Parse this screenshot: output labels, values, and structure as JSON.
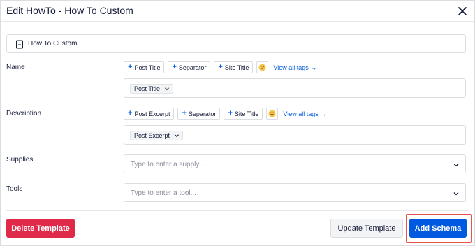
{
  "header": {
    "title": "Edit HowTo - How To Custom"
  },
  "title_field": {
    "value": "How To Custom"
  },
  "name": {
    "label": "Name",
    "tags": [
      "Post Title",
      "Separator",
      "Site Title"
    ],
    "emoji": "😀",
    "view_all": "View all tags →",
    "chip": "Post Title"
  },
  "description": {
    "label": "Description",
    "tags": [
      "Post Excerpt",
      "Separator",
      "Site Title"
    ],
    "emoji": "😀",
    "view_all": "View all tags →",
    "chip": "Post Excerpt"
  },
  "supplies": {
    "label": "Supplies",
    "placeholder": "Type to enter a supply..."
  },
  "tools": {
    "label": "Tools",
    "placeholder": "Type to enter a tool..."
  },
  "footer": {
    "delete_label": "Delete Template",
    "update_label": "Update Template",
    "add_label": "Add Schema"
  },
  "colors": {
    "accent": "#005ae0",
    "danger": "#df2a4a",
    "highlight": "#e5534b"
  }
}
